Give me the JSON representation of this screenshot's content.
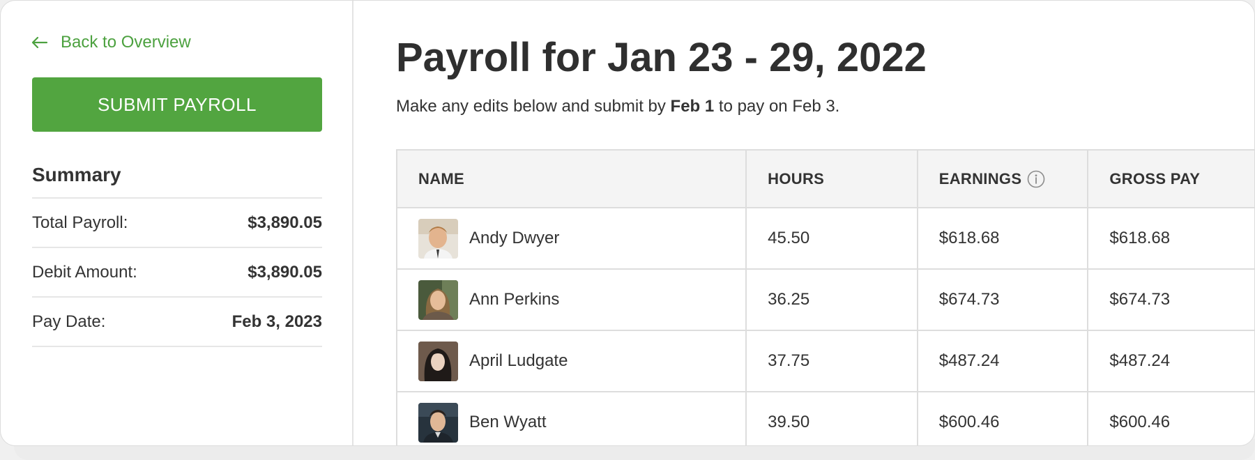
{
  "sidebar": {
    "back_label": "Back to Overview",
    "submit_label": "SUBMIT PAYROLL",
    "summary_title": "Summary",
    "summary": [
      {
        "label": "Total Payroll:",
        "value": "$3,890.05"
      },
      {
        "label": "Debit Amount:",
        "value": "$3,890.05"
      },
      {
        "label": "Pay Date:",
        "value": "Feb 3, 2023"
      }
    ]
  },
  "main": {
    "title": "Payroll for Jan 23 - 29, 2022",
    "subtitle_pre": "Make any edits below and submit by ",
    "subtitle_bold": "Feb 1",
    "subtitle_post": " to pay on Feb 3."
  },
  "table": {
    "headers": {
      "name": "NAME",
      "hours": "HOURS",
      "earnings": "EARNINGS",
      "gross": "GROSS PAY"
    },
    "rows": [
      {
        "name": "Andy Dwyer",
        "hours": "45.50",
        "earnings": "$618.68",
        "gross": "$618.68"
      },
      {
        "name": "Ann Perkins",
        "hours": "36.25",
        "earnings": "$674.73",
        "gross": "$674.73"
      },
      {
        "name": "April Ludgate",
        "hours": "37.75",
        "earnings": "$487.24",
        "gross": "$487.24"
      },
      {
        "name": "Ben Wyatt",
        "hours": "39.50",
        "earnings": "$600.46",
        "gross": "$600.46"
      }
    ]
  },
  "colors": {
    "accent": "#52a540",
    "link": "#4ca13f"
  },
  "icons": {
    "back": "arrow-left-icon",
    "info": "info-icon"
  }
}
